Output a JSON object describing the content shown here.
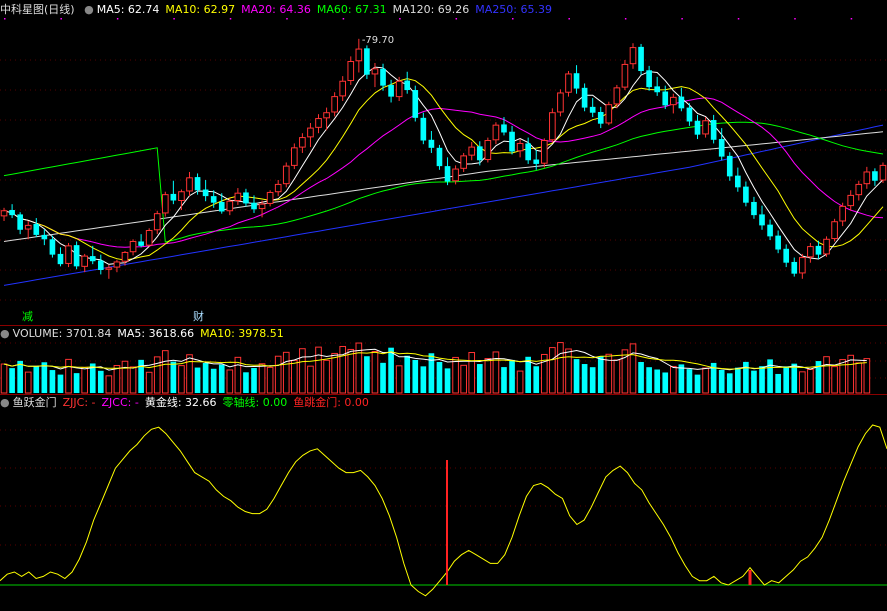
{
  "price_panel": {
    "title": "中科星图(日线)",
    "ma_labels": [
      {
        "text": "MA5: 62.74",
        "color": "#ffffff"
      },
      {
        "text": "MA10: 62.97",
        "color": "#ffff00"
      },
      {
        "text": "MA20: 64.36",
        "color": "#ff00ff"
      },
      {
        "text": "MA60: 67.31",
        "color": "#00ff00"
      },
      {
        "text": "MA120: 69.26",
        "color": "#dddddd"
      },
      {
        "text": "MA250: 65.39",
        "color": "#3333ff"
      }
    ],
    "high_label": "79.70",
    "markers": [
      {
        "text": "减",
        "color": "#00ff00"
      },
      {
        "text": "财",
        "color": "#aaddff"
      }
    ]
  },
  "volume_panel": {
    "labels": [
      {
        "text": "VOLUME: 3701.84",
        "color": "#dddddd"
      },
      {
        "text": "MA5: 3618.66",
        "color": "#ffffff"
      },
      {
        "text": "MA10: 3978.51",
        "color": "#ffff00"
      }
    ]
  },
  "indicator_panel": {
    "labels": [
      {
        "text": "鱼跃金门",
        "color": "#dddddd"
      },
      {
        "text": "ZJJC: -",
        "color": "#ff3333"
      },
      {
        "text": "ZJCC: -",
        "color": "#ff00ff"
      },
      {
        "text": "黄金线: 32.66",
        "color": "#ffffff"
      },
      {
        "text": "零轴线: 0.00",
        "color": "#00ff00"
      },
      {
        "text": "鱼跳金门: 0.00",
        "color": "#ff2222"
      }
    ]
  },
  "colors": {
    "up": "#ff3333",
    "down": "#00ffff",
    "ma250": "#2233ff",
    "indicator": "#ffff00",
    "zero": "#00cc00"
  },
  "chart_data": [
    {
      "type": "candlestick",
      "title": "中科星图(日线)",
      "ohlc": [
        [
          55.5,
          56.6,
          54.8,
          56.2
        ],
        [
          56.3,
          57.1,
          55.2,
          55.6
        ],
        [
          55.7,
          56.0,
          53.0,
          53.6
        ],
        [
          53.7,
          54.8,
          52.3,
          54.2
        ],
        [
          54.4,
          55.2,
          52.6,
          52.9
        ],
        [
          52.9,
          53.7,
          51.5,
          52.3
        ],
        [
          52.3,
          52.8,
          49.8,
          50.2
        ],
        [
          50.3,
          51.2,
          48.6,
          48.9
        ],
        [
          49.0,
          51.8,
          48.5,
          51.4
        ],
        [
          51.5,
          52.0,
          48.2,
          48.6
        ],
        [
          48.6,
          50.3,
          47.8,
          50.0
        ],
        [
          50.0,
          51.4,
          48.9,
          49.3
        ],
        [
          49.4,
          50.2,
          47.5,
          48.1
        ],
        [
          48.2,
          48.8,
          46.9,
          48.4
        ],
        [
          48.5,
          49.5,
          47.8,
          49.2
        ],
        [
          49.3,
          50.7,
          48.7,
          50.5
        ],
        [
          50.6,
          52.3,
          50.1,
          52.0
        ],
        [
          52.0,
          53.0,
          51.2,
          51.4
        ],
        [
          51.5,
          53.8,
          51.3,
          53.5
        ],
        [
          53.6,
          56.2,
          53.0,
          55.8
        ],
        [
          55.9,
          58.8,
          55.4,
          58.4
        ],
        [
          58.5,
          60.3,
          57.1,
          57.6
        ],
        [
          57.6,
          59.1,
          56.3,
          58.8
        ],
        [
          58.9,
          61.5,
          58.2,
          60.7
        ],
        [
          60.8,
          61.3,
          58.4,
          59.0
        ],
        [
          59.1,
          60.4,
          57.5,
          58.2
        ],
        [
          58.2,
          59.0,
          56.6,
          57.3
        ],
        [
          57.4,
          58.6,
          55.8,
          56.1
        ],
        [
          56.2,
          57.9,
          55.6,
          57.5
        ],
        [
          57.6,
          59.3,
          57.0,
          58.6
        ],
        [
          58.7,
          59.2,
          56.8,
          57.2
        ],
        [
          57.3,
          58.3,
          55.9,
          56.4
        ],
        [
          56.5,
          57.6,
          55.3,
          57.1
        ],
        [
          57.2,
          59.0,
          56.8,
          58.7
        ],
        [
          58.8,
          60.4,
          58.2,
          59.8
        ],
        [
          59.9,
          62.8,
          59.4,
          62.3
        ],
        [
          62.4,
          65.4,
          61.9,
          64.8
        ],
        [
          64.9,
          66.8,
          64.1,
          66.2
        ],
        [
          66.3,
          68.2,
          64.9,
          67.5
        ],
        [
          67.6,
          69.4,
          66.8,
          68.8
        ],
        [
          68.9,
          70.3,
          67.2,
          69.6
        ],
        [
          69.7,
          72.4,
          69.1,
          71.8
        ],
        [
          71.9,
          74.6,
          71.2,
          73.9
        ],
        [
          74.0,
          77.3,
          73.4,
          76.6
        ],
        [
          76.7,
          79.7,
          75.1,
          78.3
        ],
        [
          78.4,
          78.8,
          74.2,
          74.8
        ],
        [
          74.9,
          76.4,
          73.1,
          75.6
        ],
        [
          75.6,
          76.3,
          72.6,
          73.3
        ],
        [
          73.4,
          74.1,
          71.0,
          71.8
        ],
        [
          71.8,
          74.5,
          71.2,
          73.9
        ],
        [
          74.0,
          75.2,
          72.2,
          72.7
        ],
        [
          72.7,
          73.3,
          68.4,
          68.9
        ],
        [
          68.9,
          69.6,
          65.3,
          65.8
        ],
        [
          65.9,
          67.1,
          64.1,
          64.8
        ],
        [
          64.8,
          65.2,
          61.8,
          62.3
        ],
        [
          62.3,
          63.5,
          59.7,
          60.2
        ],
        [
          60.3,
          62.4,
          59.8,
          61.9
        ],
        [
          62.0,
          64.1,
          61.5,
          63.7
        ],
        [
          63.8,
          65.6,
          63.1,
          64.9
        ],
        [
          65.0,
          65.7,
          62.4,
          63.1
        ],
        [
          63.2,
          66.2,
          62.8,
          65.8
        ],
        [
          65.9,
          68.3,
          65.3,
          67.9
        ],
        [
          68.0,
          69.0,
          66.5,
          66.9
        ],
        [
          67.0,
          67.8,
          63.9,
          64.3
        ],
        [
          64.4,
          66.0,
          63.5,
          65.4
        ],
        [
          65.4,
          66.2,
          62.6,
          63.1
        ],
        [
          63.2,
          64.5,
          61.8,
          62.6
        ],
        [
          62.7,
          66.1,
          62.1,
          65.8
        ],
        [
          65.9,
          70.2,
          65.5,
          69.6
        ],
        [
          69.7,
          72.8,
          69.1,
          72.3
        ],
        [
          72.4,
          75.3,
          71.8,
          74.9
        ],
        [
          75.0,
          76.1,
          72.2,
          72.9
        ],
        [
          73.0,
          73.6,
          69.8,
          70.3
        ],
        [
          70.4,
          71.6,
          69.0,
          69.6
        ],
        [
          69.7,
          70.4,
          67.5,
          68.1
        ],
        [
          68.2,
          71.1,
          67.9,
          70.7
        ],
        [
          70.8,
          73.4,
          70.2,
          73.0
        ],
        [
          73.1,
          76.8,
          72.7,
          76.2
        ],
        [
          76.3,
          79.1,
          75.6,
          78.5
        ],
        [
          78.6,
          79.0,
          74.8,
          75.3
        ],
        [
          75.4,
          76.0,
          72.6,
          73.1
        ],
        [
          73.2,
          74.5,
          71.9,
          72.4
        ],
        [
          72.5,
          73.3,
          70.1,
          70.6
        ],
        [
          70.7,
          72.2,
          69.5,
          71.7
        ],
        [
          71.8,
          73.0,
          69.8,
          70.2
        ],
        [
          70.3,
          70.9,
          67.8,
          68.4
        ],
        [
          68.5,
          69.3,
          66.0,
          66.6
        ],
        [
          66.7,
          69.0,
          66.2,
          68.5
        ],
        [
          68.6,
          69.3,
          65.4,
          65.9
        ],
        [
          66.0,
          67.5,
          63.1,
          63.6
        ],
        [
          63.7,
          64.2,
          60.3,
          60.9
        ],
        [
          61.0,
          62.1,
          58.8,
          59.4
        ],
        [
          59.5,
          60.2,
          56.8,
          57.3
        ],
        [
          57.4,
          58.1,
          55.1,
          55.6
        ],
        [
          55.7,
          56.9,
          53.6,
          54.2
        ],
        [
          54.3,
          55.0,
          52.2,
          52.7
        ],
        [
          52.8,
          53.5,
          50.4,
          50.9
        ],
        [
          51.0,
          51.6,
          48.5,
          49.1
        ],
        [
          49.2,
          49.8,
          47.2,
          47.6
        ],
        [
          47.7,
          50.3,
          46.9,
          49.8
        ],
        [
          49.9,
          51.8,
          49.1,
          51.3
        ],
        [
          51.4,
          52.1,
          49.6,
          50.2
        ],
        [
          50.3,
          52.7,
          49.9,
          52.3
        ],
        [
          52.4,
          55.1,
          52.0,
          54.7
        ],
        [
          54.8,
          57.3,
          54.1,
          56.8
        ],
        [
          56.9,
          59.0,
          56.2,
          58.3
        ],
        [
          58.4,
          60.3,
          57.6,
          59.8
        ],
        [
          59.9,
          62.2,
          59.2,
          61.5
        ],
        [
          61.6,
          62.0,
          59.6,
          60.3
        ],
        [
          60.4,
          62.8,
          60.0,
          62.4
        ]
      ],
      "ma_values": {
        "MA5": 62.74,
        "MA10": 62.97,
        "MA20": 64.36,
        "MA60": 67.31,
        "MA120": 69.26,
        "MA250": 65.39
      },
      "annotations": [
        "79.70",
        "减",
        "财"
      ]
    },
    {
      "type": "bar",
      "title": "VOLUME",
      "values": [
        3120,
        2680,
        3460,
        2250,
        2890,
        3310,
        2470,
        1980,
        3620,
        2140,
        2760,
        3180,
        2390,
        1850,
        2960,
        3420,
        2810,
        3570,
        2230,
        3890,
        4560,
        3380,
        2950,
        4120,
        2740,
        3230,
        2610,
        3050,
        2480,
        3840,
        2230,
        2690,
        3150,
        2760,
        3960,
        4380,
        3510,
        4770,
        2890,
        4940,
        3520,
        4260,
        5010,
        4690,
        5380,
        3960,
        4470,
        3250,
        4880,
        2930,
        4010,
        3560,
        2870,
        4280,
        3340,
        2650,
        3830,
        2980,
        4360,
        3120,
        3710,
        4420,
        2790,
        3560,
        2360,
        3900,
        2880,
        4150,
        4890,
        5430,
        4740,
        3650,
        3120,
        2780,
        3940,
        4170,
        3560,
        4650,
        5290,
        3340,
        2780,
        2530,
        2210,
        2860,
        3080,
        2570,
        1980,
        2690,
        3240,
        2480,
        2120,
        2730,
        3350,
        2410,
        2890,
        3620,
        2050,
        2870,
        3160,
        2280,
        2530,
        3440,
        3910,
        2840,
        3600,
        4060,
        3250,
        3701.84
      ],
      "ma_values": {
        "MA5": 3618.66,
        "MA10": 3978.51
      }
    },
    {
      "type": "line",
      "title": "鱼跃金门",
      "series": [
        {
          "name": "黄金线",
          "values": [
            2,
            5,
            6,
            4,
            6,
            3,
            4,
            6,
            5,
            3,
            6,
            12,
            20,
            30,
            38,
            46,
            54,
            58,
            62,
            65,
            69,
            72,
            73,
            70,
            66,
            62,
            57,
            52,
            50,
            48,
            44,
            41,
            39,
            36,
            34,
            33,
            33,
            35,
            40,
            46,
            52,
            57,
            60,
            62,
            63,
            60,
            57,
            54,
            52,
            52,
            53,
            50,
            46,
            40,
            32,
            22,
            10,
            0,
            -3,
            -5,
            -2,
            2,
            6,
            11,
            14,
            16,
            14,
            12,
            10,
            10,
            14,
            22,
            32,
            41,
            46,
            47,
            45,
            42,
            40,
            32,
            28,
            30,
            36,
            43,
            50,
            53,
            55,
            52,
            47,
            44,
            38,
            33,
            28,
            22,
            15,
            9,
            4,
            2,
            2,
            4,
            1,
            0,
            2,
            4,
            8,
            4,
            0,
            2,
            1,
            4,
            7,
            11,
            13,
            17,
            22,
            30,
            39,
            48,
            56,
            64,
            70,
            74,
            73,
            63
          ]
        },
        {
          "name": "零轴线",
          "values": [
            0
          ]
        }
      ],
      "values_label": {
        "黄金线": 32.66,
        "零轴线": 0.0,
        "鱼跳金门": 0.0,
        "ZJJC": "-",
        "ZJCC": "-"
      }
    }
  ]
}
